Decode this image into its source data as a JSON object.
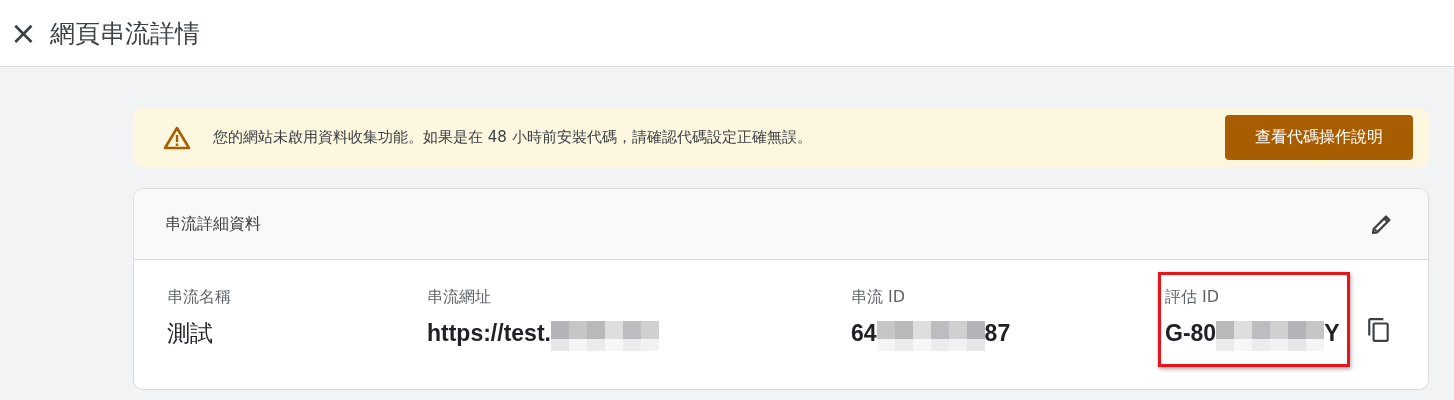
{
  "header": {
    "close_icon": "×",
    "title": "網頁串流詳情"
  },
  "alert": {
    "message": "您的網站未啟用資料收集功能。如果是在 48 小時前安裝代碼，請確認代碼設定正確無誤。",
    "button": "查看代碼操作說明"
  },
  "details": {
    "title": "串流詳細資料",
    "fields": [
      {
        "label": "串流名稱",
        "kind": "plain",
        "highlighted": false,
        "copyable": false,
        "parts": [
          {
            "kind": "text",
            "text": "測試"
          }
        ]
      },
      {
        "label": "串流網址",
        "kind": "bold",
        "highlighted": false,
        "copyable": false,
        "parts": [
          {
            "kind": "text",
            "text": "https://test."
          },
          {
            "kind": "redacted"
          }
        ]
      },
      {
        "label": "串流 ID",
        "kind": "bold",
        "highlighted": false,
        "copyable": false,
        "parts": [
          {
            "kind": "text",
            "text": "64"
          },
          {
            "kind": "redacted"
          },
          {
            "kind": "text",
            "text": "87"
          }
        ]
      },
      {
        "label": "評估 ID",
        "kind": "bold",
        "highlighted": true,
        "copyable": true,
        "parts": [
          {
            "kind": "text",
            "text": "G-80"
          },
          {
            "kind": "redacted"
          },
          {
            "kind": "text",
            "text": "Y"
          }
        ]
      }
    ]
  }
}
